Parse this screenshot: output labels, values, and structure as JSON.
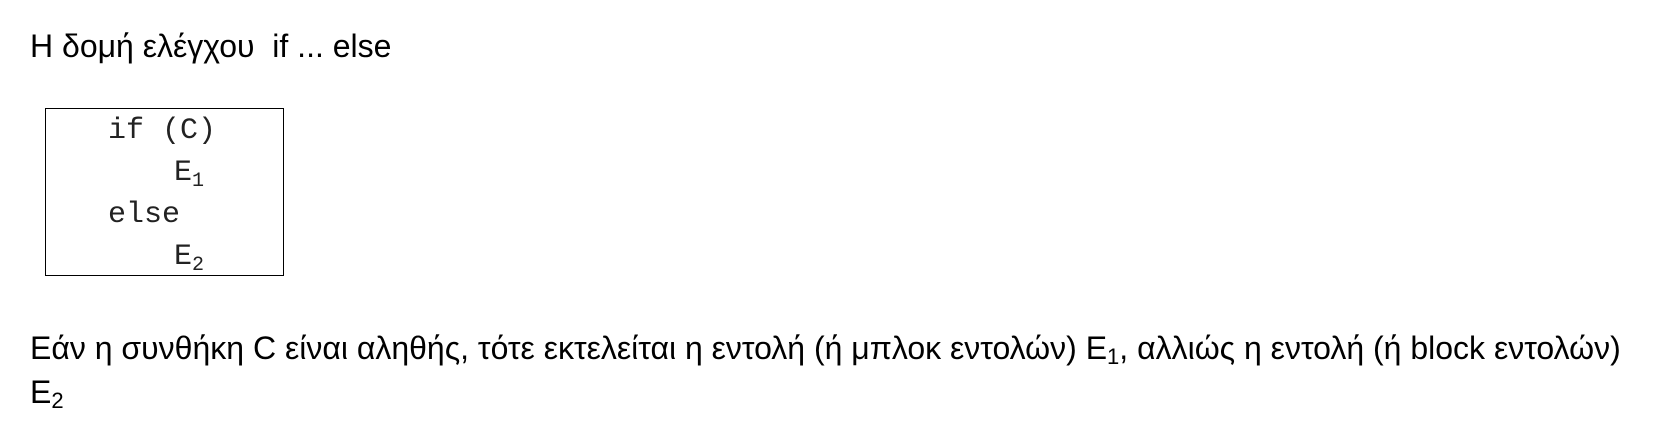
{
  "heading": "Η δομή ελέγχου  if ... else",
  "code": {
    "line1": "if (C)",
    "line2_main": "E",
    "line2_sub": "1",
    "line3": "else",
    "line4_main": "E",
    "line4_sub": "2"
  },
  "description": {
    "part1": "Εάν η συνθήκη C είναι αληθής, τότε εκτελείται η εντολή (ή μπλοκ εντολών) E",
    "sub1": "1",
    "part2": ", αλλιώς η εντολή (ή block εντολών) E",
    "sub2": "2"
  }
}
